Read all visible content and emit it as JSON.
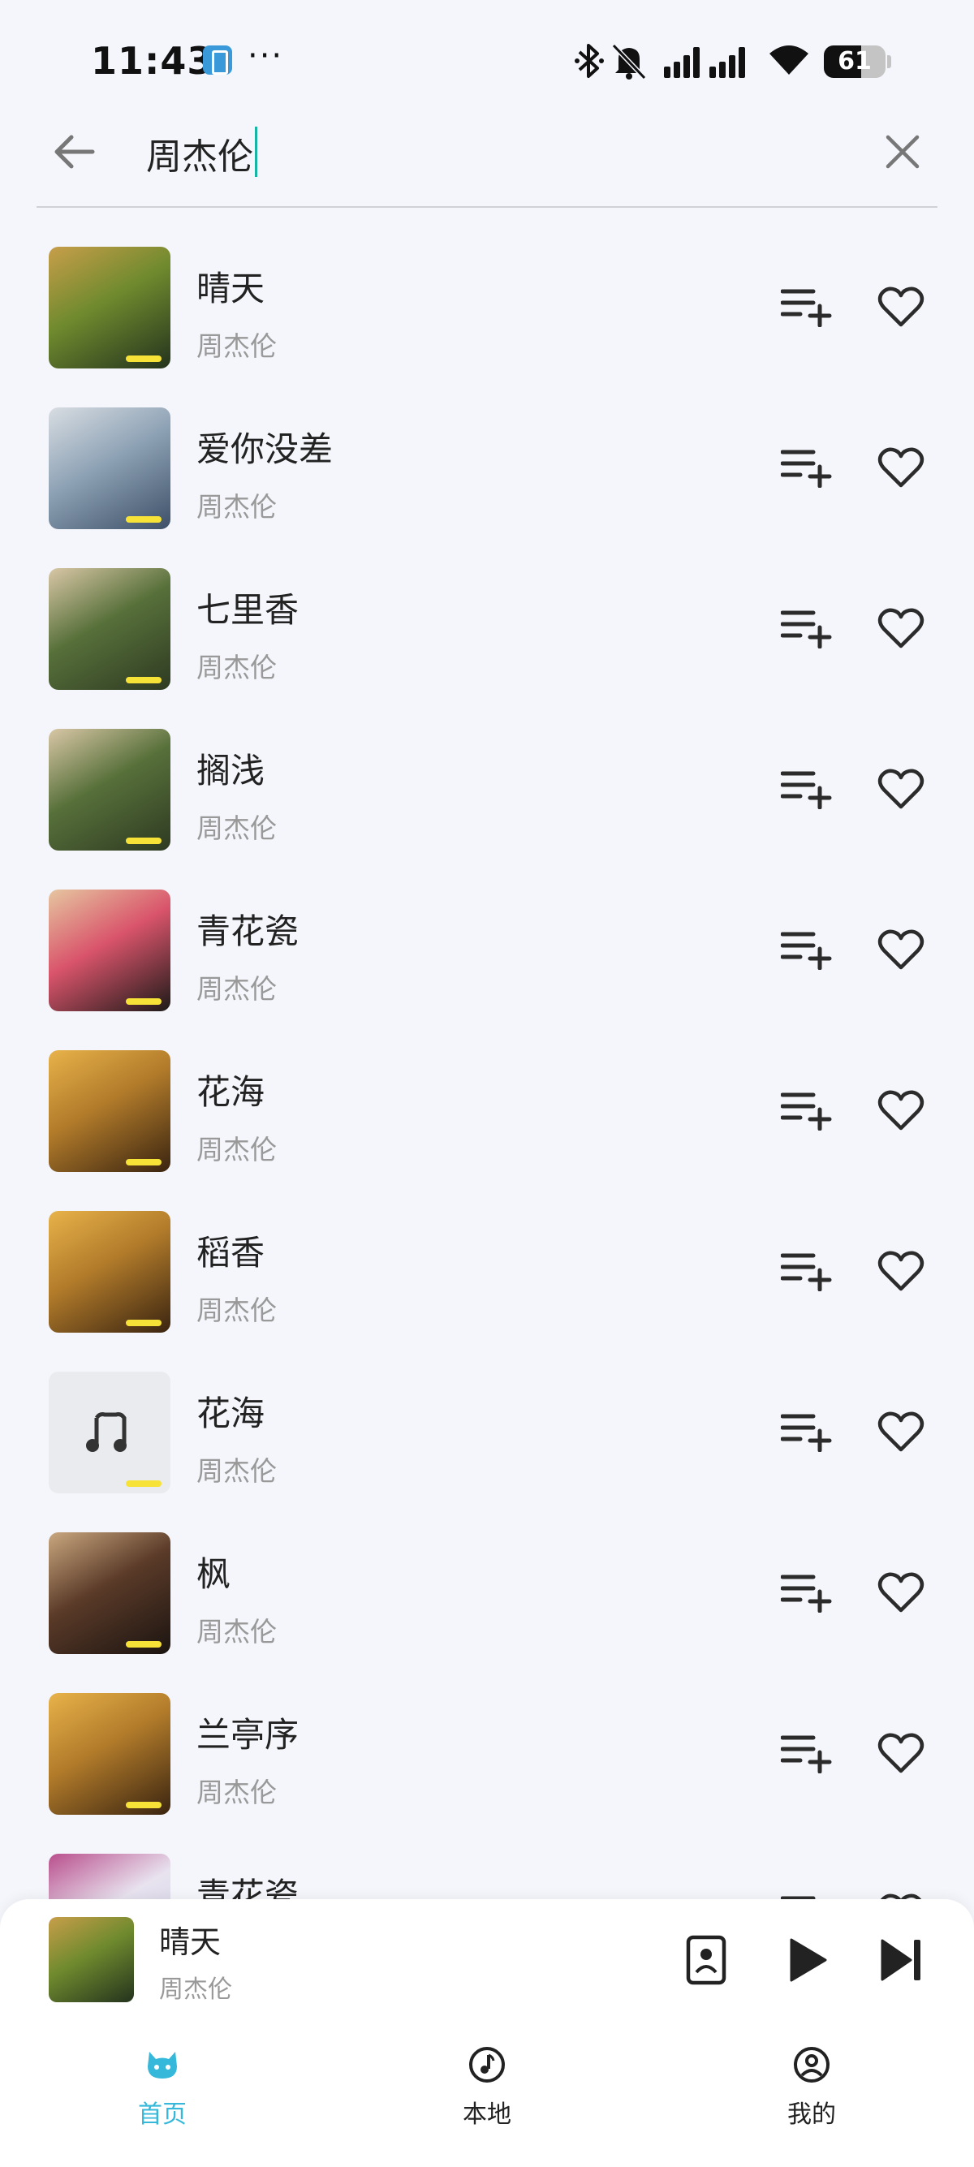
{
  "status_bar": {
    "time": "11:43",
    "battery": "61",
    "battery_level": 0.61,
    "icons": [
      "app-notification-icon",
      "more-dots-icon",
      "bluetooth-icon",
      "bell-muted-icon",
      "cell-signal-icon",
      "wifi-icon",
      "battery-icon"
    ]
  },
  "search": {
    "query": "周杰伦",
    "back_icon": "arrow-left-icon",
    "clear_icon": "close-icon",
    "caret_color": "#17b3a3"
  },
  "songs": [
    {
      "title": "晴天",
      "artist": "周杰伦",
      "cover_colors": [
        "#23331d",
        "#6f8a2e",
        "#c89e4a"
      ]
    },
    {
      "title": "爱你没差",
      "artist": "周杰伦",
      "cover_colors": [
        "#3d5068",
        "#8fa3b6",
        "#d8dde2"
      ]
    },
    {
      "title": "七里香",
      "artist": "周杰伦",
      "cover_colors": [
        "#2e3a22",
        "#57703a",
        "#d9c7a6"
      ]
    },
    {
      "title": "搁浅",
      "artist": "周杰伦",
      "cover_colors": [
        "#2e3a22",
        "#57703a",
        "#d9c7a6"
      ]
    },
    {
      "title": "青花瓷",
      "artist": "周杰伦",
      "cover_colors": [
        "#1d1a18",
        "#d9546b",
        "#e6c6a0"
      ]
    },
    {
      "title": "花海",
      "artist": "周杰伦",
      "cover_colors": [
        "#3a2410",
        "#b07a2a",
        "#e8b24a"
      ]
    },
    {
      "title": "稻香",
      "artist": "周杰伦",
      "cover_colors": [
        "#3a2410",
        "#b07a2a",
        "#e8b24a"
      ]
    },
    {
      "title": "花海",
      "artist": "周杰伦",
      "cover_colors": [
        "#e9ebee",
        "#e9ebee",
        "#e9ebee"
      ],
      "placeholder": true
    },
    {
      "title": "枫",
      "artist": "周杰伦",
      "cover_colors": [
        "#1b1411",
        "#5a3a28",
        "#c9a77f"
      ]
    },
    {
      "title": "兰亭序",
      "artist": "周杰伦",
      "cover_colors": [
        "#3a2410",
        "#b07a2a",
        "#e8b24a"
      ]
    },
    {
      "title": "青花瓷",
      "artist": "",
      "cover_colors": [
        "#c7c9e2",
        "#e8e3ef",
        "#b94f8d"
      ]
    }
  ],
  "row_icons": {
    "add": "playlist-add-icon",
    "like": "heart-outline-icon"
  },
  "now_playing": {
    "title": "晴天",
    "artist": "周杰伦",
    "cover_colors": [
      "#23331d",
      "#6f8a2e",
      "#c89e4a"
    ]
  },
  "nav": {
    "active_color": "#35b8da",
    "items": [
      {
        "label": "首页",
        "icon": "cat-icon",
        "active": true
      },
      {
        "label": "本地",
        "icon": "music-note-circle-icon",
        "active": false
      },
      {
        "label": "我的",
        "icon": "user-circle-icon",
        "active": false
      }
    ]
  }
}
